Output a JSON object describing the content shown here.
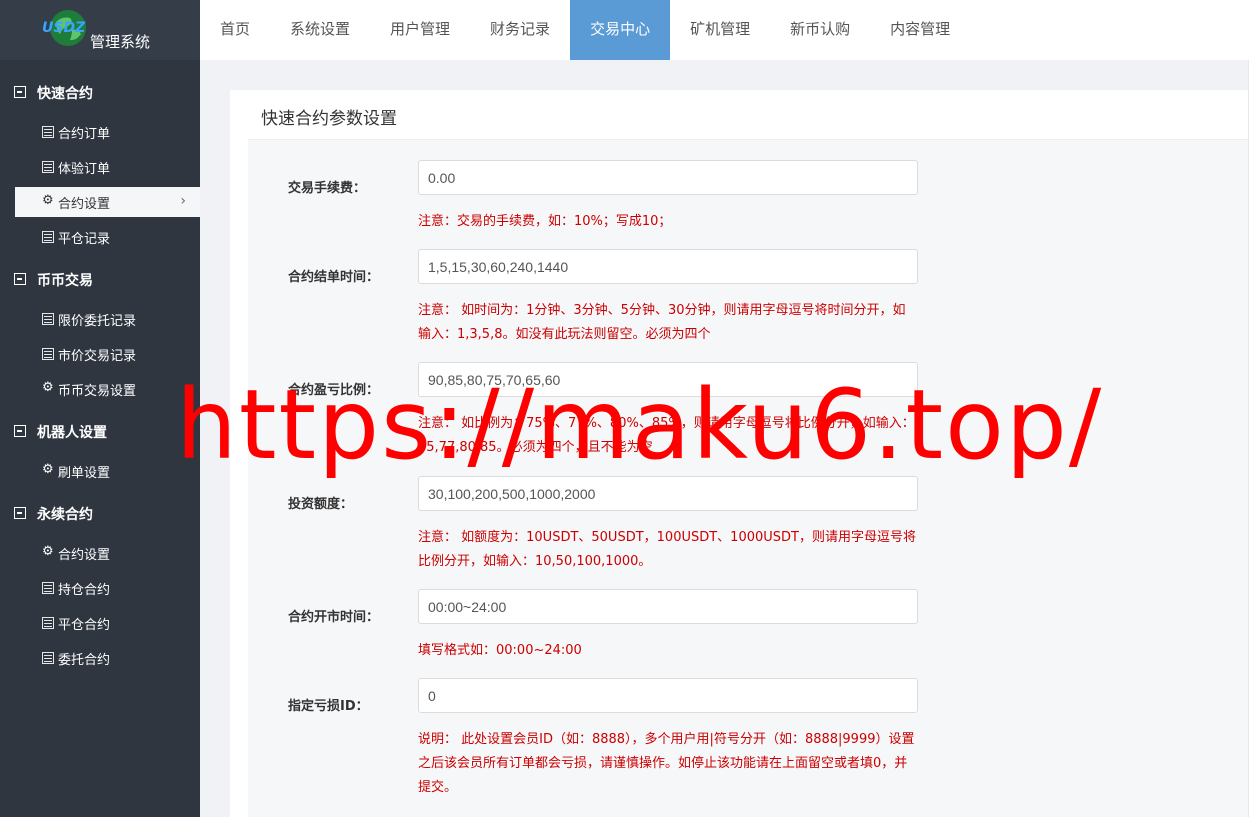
{
  "brand": {
    "mark": "USDZ",
    "title": "管理系统"
  },
  "topnav": [
    {
      "label": "首页",
      "active": false
    },
    {
      "label": "系统设置",
      "active": false
    },
    {
      "label": "用户管理",
      "active": false
    },
    {
      "label": "财务记录",
      "active": false
    },
    {
      "label": "交易中心",
      "active": true
    },
    {
      "label": "矿机管理",
      "active": false
    },
    {
      "label": "新币认购",
      "active": false
    },
    {
      "label": "内容管理",
      "active": false
    }
  ],
  "sidebar": {
    "groups": [
      {
        "label": "快速合约",
        "items": [
          {
            "label": "合约订单",
            "icon": "doc-icon"
          },
          {
            "label": "体验订单",
            "icon": "doc-icon"
          },
          {
            "label": "合约设置",
            "icon": "gear-icon",
            "active": true
          },
          {
            "label": "平仓记录",
            "icon": "doc-icon"
          }
        ]
      },
      {
        "label": "币币交易",
        "items": [
          {
            "label": "限价委托记录",
            "icon": "doc-icon"
          },
          {
            "label": "市价交易记录",
            "icon": "doc-icon"
          },
          {
            "label": "币币交易设置",
            "icon": "gear-icon"
          }
        ]
      },
      {
        "label": "机器人设置",
        "items": [
          {
            "label": "刷单设置",
            "icon": "gear-icon"
          }
        ]
      },
      {
        "label": "永续合约",
        "items": [
          {
            "label": "合约设置",
            "icon": "gear-icon"
          },
          {
            "label": "持仓合约",
            "icon": "doc-icon"
          },
          {
            "label": "平仓合约",
            "icon": "doc-icon"
          },
          {
            "label": "委托合约",
            "icon": "doc-icon"
          }
        ]
      }
    ]
  },
  "panel": {
    "title": "快速合约参数设置",
    "fields": [
      {
        "label": "交易手续费：",
        "value": "0.00",
        "note": "注意：交易的手续费，如：10%；写成10；"
      },
      {
        "label": "合约结单时间：",
        "value": "1,5,15,30,60,240,1440",
        "note": "注意： 如时间为：1分钟、3分钟、5分钟、30分钟，则请用字母逗号将时间分开，如输入：1,3,5,8。如没有此玩法则留空。必须为四个"
      },
      {
        "label": "合约盈亏比例：",
        "value": "90,85,80,75,70,65,60",
        "note": "注意： 如比例为：75%、77%、80%、85%，则请用字母逗号将比例分开，如输入：75,77,80,85。必须为四个，且不能为空"
      },
      {
        "label": "投资额度：",
        "value": "30,100,200,500,1000,2000",
        "note": "注意： 如额度为：10USDT、50USDT，100USDT、1000USDT，则请用字母逗号将比例分开，如输入：10,50,100,1000。"
      },
      {
        "label": "合约开市时间：",
        "value": "00:00~24:00",
        "note": "填写格式如：00:00~24:00"
      },
      {
        "label": "指定亏损ID：",
        "value": "0",
        "note": "说明： 此处设置会员ID（如：8888），多个用户用|符号分开（如：8888|9999）设置之后该会员所有订单都会亏损，请谨慎操作。如停止该功能请在上面留空或者填0，并提交。"
      }
    ]
  },
  "watermark": "https://maku6.top/",
  "colors": {
    "sidebar": "#2f3640",
    "active_nav": "#5b9bd5",
    "note": "#cc0000",
    "watermark": "#ff0000"
  }
}
